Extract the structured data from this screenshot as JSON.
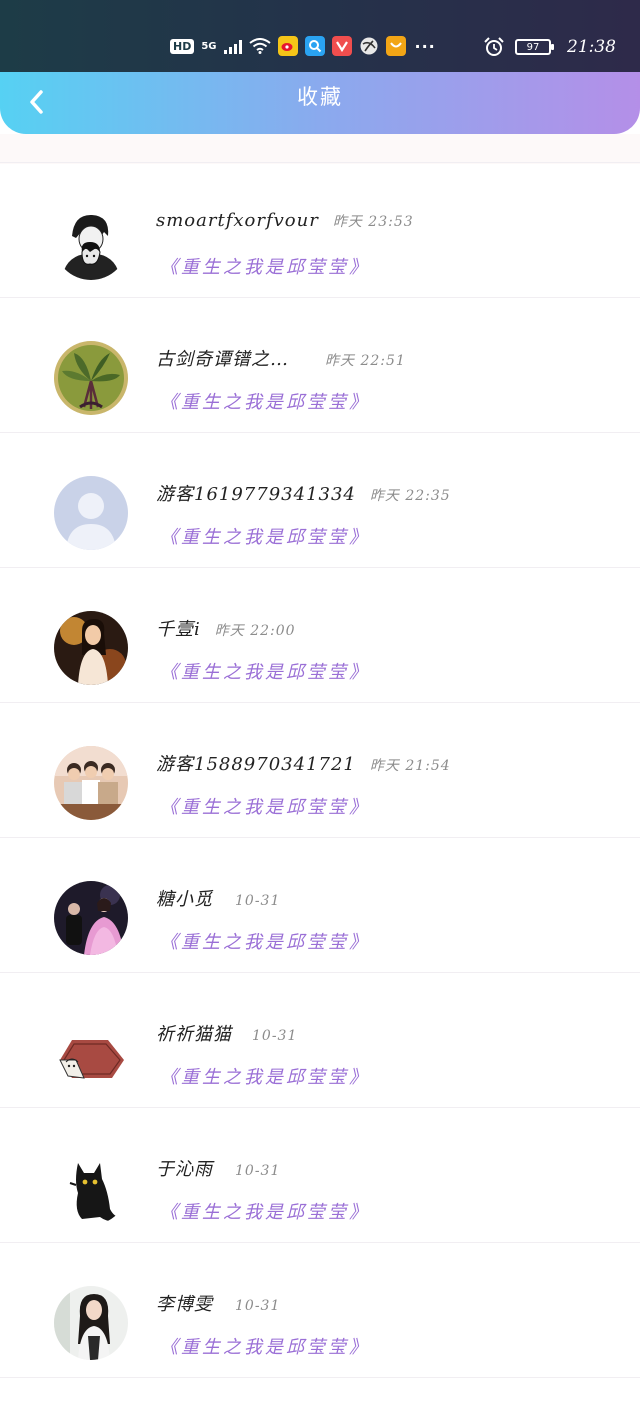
{
  "status_bar": {
    "hd": "HD",
    "network": "5G",
    "battery": "97",
    "time": "21:38",
    "icons": [
      "signal-icon",
      "wifi-icon",
      "weibo-icon",
      "search-app-icon",
      "video-app-icon",
      "browser-icon",
      "reader-app-icon",
      "more-icon",
      "alarm-icon",
      "battery-icon"
    ],
    "more": "···"
  },
  "header": {
    "title": "收藏",
    "back_icon": "chevron-left-icon",
    "gradient": [
      "#56d1f3",
      "#b48fe8"
    ]
  },
  "colors": {
    "link": "#9a6fd6",
    "name": "#222222",
    "time": "#8c8c8c"
  },
  "favorites": [
    {
      "user": "smoartfxorfvour",
      "time": "昨天 23:53",
      "book": "《重生之我是邱莹莹》",
      "avatar": "anime-couple-avatar"
    },
    {
      "user": "古剑奇谭镨之…",
      "time": "昨天 22:51",
      "book": "《重生之我是邱莹莹》",
      "avatar": "leaves-avatar"
    },
    {
      "user": "游客1619779341334",
      "time": "昨天 22:35",
      "book": "《重生之我是邱莹莹》",
      "avatar": "default-avatar"
    },
    {
      "user": "千壹i",
      "time": "昨天 22:00",
      "book": "《重生之我是邱莹莹》",
      "avatar": "girl-avatar"
    },
    {
      "user": "游客1588970341721",
      "time": "昨天 21:54",
      "book": "《重生之我是邱莹莹》",
      "avatar": "group-avatar"
    },
    {
      "user": "糖小觅",
      "time": "10-31",
      "book": "《重生之我是邱莹莹》",
      "avatar": "pink-dress-avatar"
    },
    {
      "user": "祈祈猫猫",
      "time": "10-31",
      "book": "《重生之我是邱莹莹》",
      "avatar": "drawing-avatar"
    },
    {
      "user": "于沁雨",
      "time": "10-31",
      "book": "《重生之我是邱莹莹》",
      "avatar": "black-cat-avatar"
    },
    {
      "user": "李博雯",
      "time": "10-31",
      "book": "《重生之我是邱莹莹》",
      "avatar": "portrait-avatar"
    }
  ]
}
